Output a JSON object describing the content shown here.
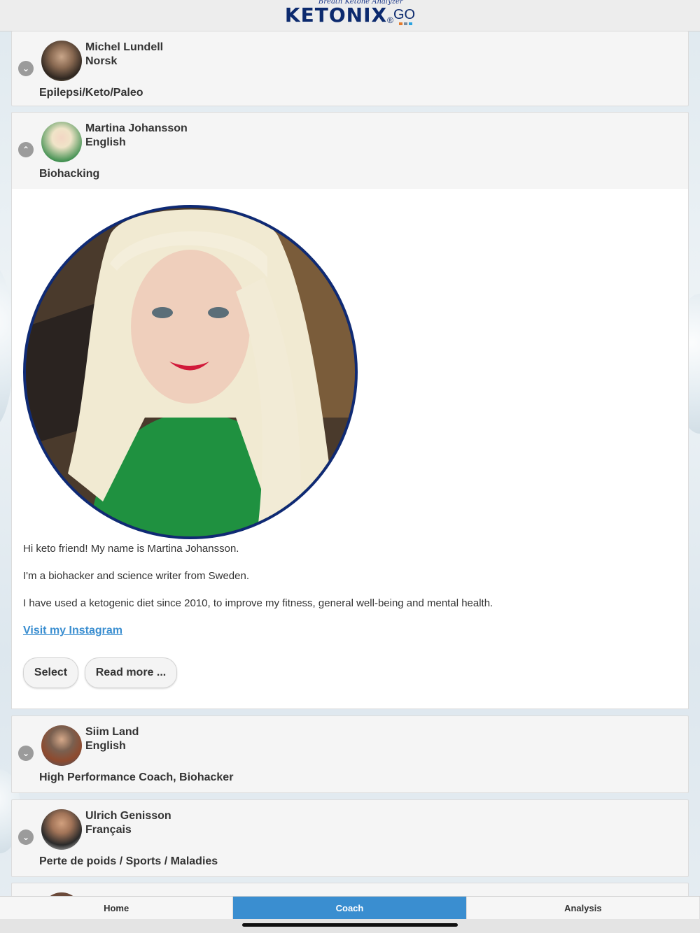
{
  "header": {
    "tagline": "Breath Ketone Analyzer",
    "brand": "KETONIX",
    "registered": "®",
    "suffix": "GO"
  },
  "coaches": [
    {
      "name": "Michel Lundell",
      "language": "Norsk",
      "specialty": "Epilepsi/Keto/Paleo",
      "expanded": false
    },
    {
      "name": "Martina Johansson",
      "language": "English",
      "specialty": "Biohacking",
      "expanded": true
    },
    {
      "name": "Siim Land",
      "language": "English",
      "specialty": "High Performance Coach, Biohacker",
      "expanded": false
    },
    {
      "name": "Ulrich Genisson",
      "language": "Français",
      "specialty": "Perte de poids / Sports / Maladies",
      "expanded": false
    }
  ],
  "detail": {
    "intro": "Hi keto friend! My name is Martina Johansson.",
    "line2": "I'm a biohacker and science writer from Sweden.",
    "line3": "I have used a ketogenic diet since 2010, to improve my fitness, general well-being and mental health.",
    "link": "Visit my Instagram",
    "select_label": "Select",
    "readmore_label": "Read more ..."
  },
  "tabs": [
    {
      "label": "Home",
      "active": false
    },
    {
      "label": "Coach",
      "active": true
    },
    {
      "label": "Analysis",
      "active": false
    }
  ],
  "colors": {
    "accent": "#3a8ed0",
    "brand": "#0c2a6e",
    "photo_border": "#0f2a74"
  }
}
